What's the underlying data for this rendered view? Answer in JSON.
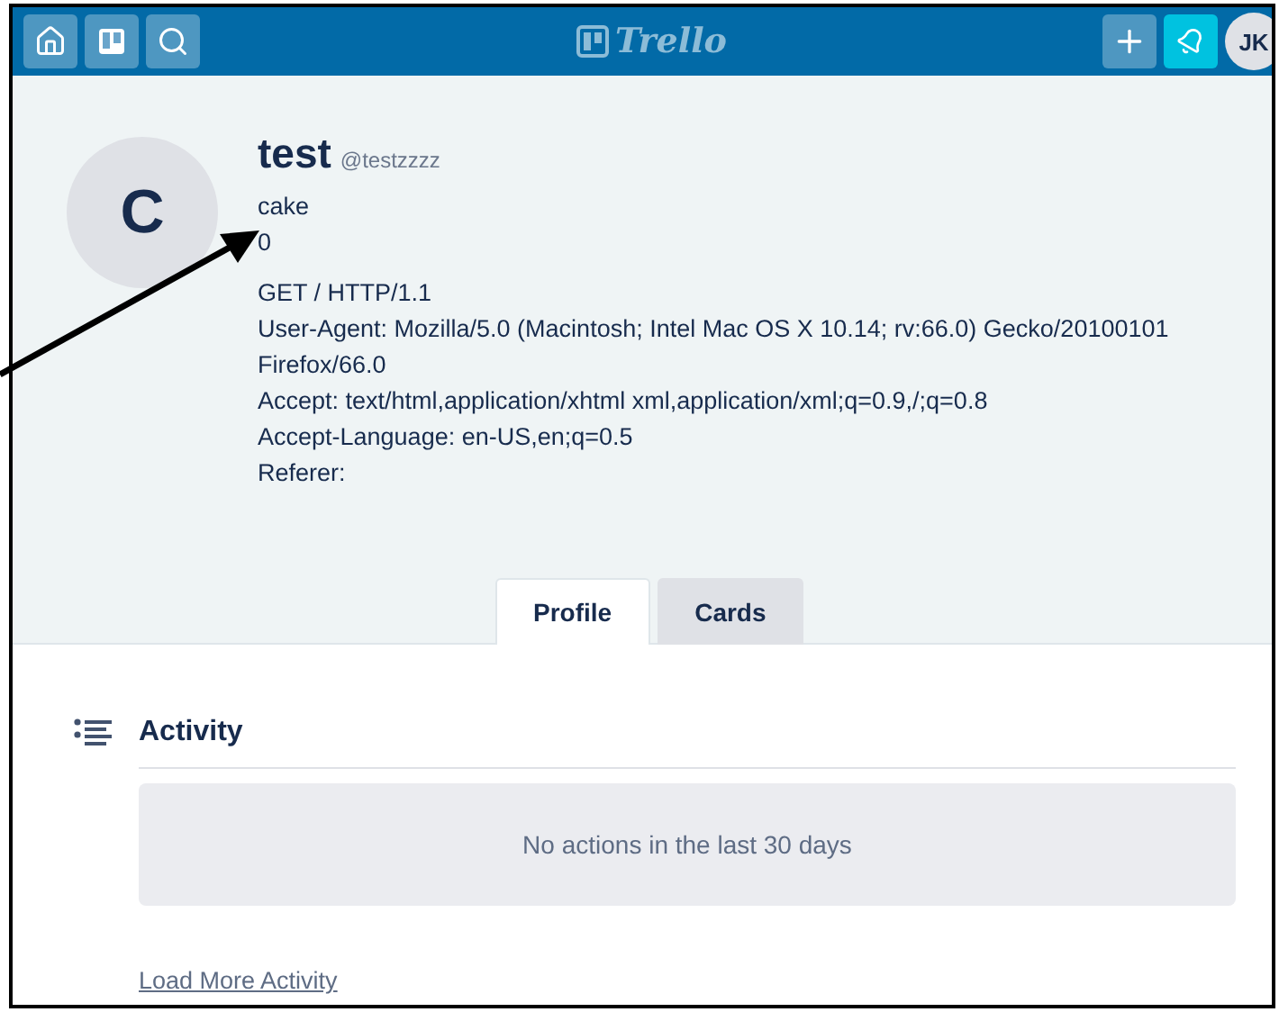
{
  "header": {
    "logo": "Trello",
    "avatar_initials": "JK"
  },
  "profile": {
    "avatar_initial": "C",
    "name": "test",
    "username": "@testzzzz",
    "lines": [
      "cake",
      "0"
    ],
    "request_lines": [
      "GET / HTTP/1.1",
      "User-Agent: Mozilla/5.0 (Macintosh; Intel Mac OS X 10.14; rv:66.0) Gecko/20100101",
      "Firefox/66.0",
      "Accept: text/html,application/xhtml xml,application/xml;q=0.9,/;q=0.8",
      "Accept-Language: en-US,en;q=0.5",
      "Referer:"
    ]
  },
  "tabs": [
    {
      "label": "Profile",
      "selected": true
    },
    {
      "label": "Cards",
      "selected": false
    }
  ],
  "activity": {
    "title": "Activity",
    "empty_message": "No actions in the last 30 days",
    "load_more": "Load More Activity"
  }
}
